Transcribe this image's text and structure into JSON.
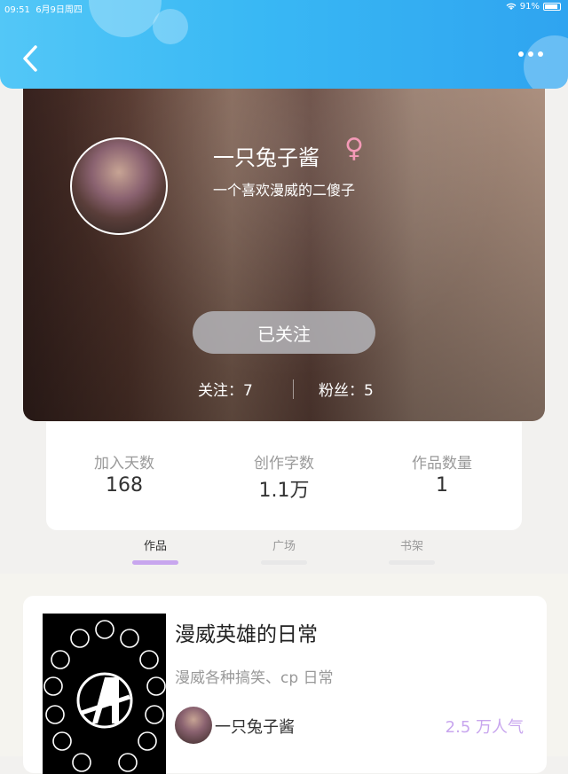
{
  "status_bar": {
    "time": "09:51",
    "date": "6月9日周四",
    "battery": "91%"
  },
  "profile": {
    "name": "一只兔子酱",
    "gender_symbol": "♀",
    "bio": "一个喜欢漫威的二傻子",
    "follow_button": "已关注",
    "following_label": "关注：7",
    "followers_label": "粉丝：5"
  },
  "stats": [
    {
      "label": "加入天数",
      "value": "168"
    },
    {
      "label": "创作字数",
      "value": "1.1万"
    },
    {
      "label": "作品数量",
      "value": "1"
    }
  ],
  "tabs": [
    {
      "label": "作品",
      "active": true
    },
    {
      "label": "广场",
      "active": false
    },
    {
      "label": "书架",
      "active": false
    }
  ],
  "work": {
    "title": "漫威英雄的日常",
    "description": "漫威各种搞笑、cp 日常",
    "author": "一只兔子酱",
    "popularity": "2.5 万人气"
  },
  "colors": {
    "header_blue": "#39b8f4",
    "accent_purple": "#c8a6ee",
    "gender_pink": "#f49ab7"
  },
  "icons": [
    "back-arrow-icon",
    "more-dots-icon",
    "wifi-icon",
    "battery-icon",
    "female-icon",
    "avengers-logo"
  ]
}
